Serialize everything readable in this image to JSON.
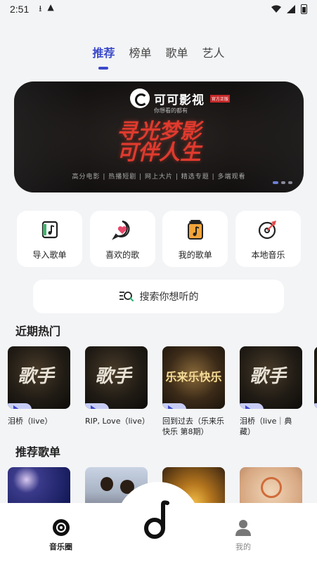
{
  "status_bar": {
    "time": "2:51"
  },
  "tabs": [
    {
      "label": "推荐",
      "active": true
    },
    {
      "label": "榜单",
      "active": false
    },
    {
      "label": "歌单",
      "active": false
    },
    {
      "label": "艺人",
      "active": false
    }
  ],
  "banner": {
    "brand": "可可影视",
    "brand_tag": "官方正版",
    "slogan": "你想看的都有",
    "title_line1": "寻光梦影",
    "title_line2": "可伴人生",
    "subtitle": "高分电影 | 热播短剧 | 网上大片 | 精选专题 | 多端观看",
    "slide_count": 3,
    "active_slide": 1
  },
  "quick_actions": [
    {
      "label": "导入歌单",
      "icon": "import-playlist-icon"
    },
    {
      "label": "喜欢的歌",
      "icon": "heart-chat-icon"
    },
    {
      "label": "我的歌单",
      "icon": "my-playlist-icon"
    },
    {
      "label": "本地音乐",
      "icon": "disc-icon"
    }
  ],
  "search": {
    "placeholder": "搜索你想听的",
    "icon": "search-list-icon"
  },
  "sections": {
    "hot": "近期热门",
    "recommended": "推荐歌单"
  },
  "hot_items": [
    {
      "name": "泪桥（live）",
      "cover_text": "歌手",
      "cover_style": "geshou"
    },
    {
      "name": "RIP, Love（live）",
      "cover_text": "歌手",
      "cover_style": "geshou"
    },
    {
      "name": "回到过去（乐来乐快乐 第8期）",
      "cover_text": "乐来乐快乐",
      "cover_style": "gold"
    },
    {
      "name": "泪桥（live｜典藏）",
      "cover_text": "歌手",
      "cover_style": "geshou"
    }
  ],
  "bottom_nav": [
    {
      "label": "音乐圈",
      "icon": "record-icon",
      "active": true
    },
    {
      "label": "",
      "icon": "music-note-d-icon",
      "active": false
    },
    {
      "label": "我的",
      "icon": "person-icon",
      "active": false
    }
  ],
  "colors": {
    "accent": "#3a49c9",
    "banner_title": "#e03a2e",
    "background": "#f3f4f6"
  }
}
